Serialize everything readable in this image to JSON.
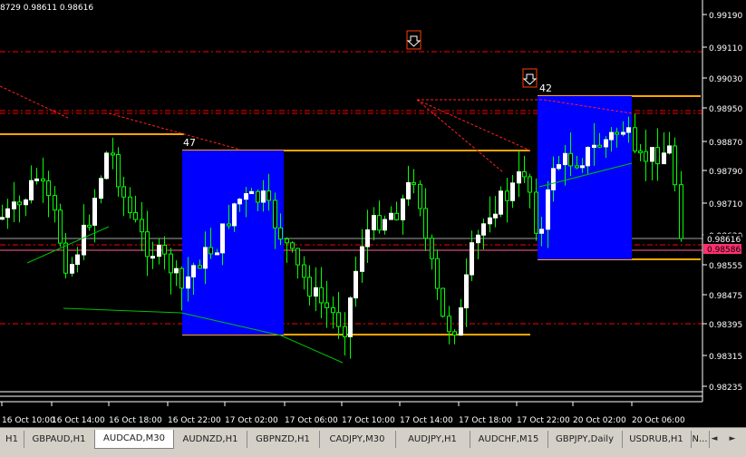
{
  "info_bar": {
    "text": "8729 0.98611 0.98616"
  },
  "price_axis": {
    "labels": [
      "0.99190",
      "0.99110",
      "0.99030",
      "0.98950",
      "0.98870",
      "0.98790",
      "0.98710",
      "0.98630",
      "0.98555",
      "0.98475",
      "0.98395",
      "0.98315",
      "0.98235"
    ],
    "current_bid": "0.98616",
    "current_ask": "0.98586"
  },
  "time_axis": {
    "labels": [
      "16 Oct 10:00",
      "16 Oct 14:00",
      "16 Oct 18:00",
      "16 Oct 22:00",
      "17 Oct 02:00",
      "17 Oct 06:00",
      "17 Oct 10:00",
      "17 Oct 14:00",
      "17 Oct 18:00",
      "17 Oct 22:00",
      "20 Oct 02:00",
      "20 Oct 06:00"
    ]
  },
  "zones": [
    {
      "label": "47"
    },
    {
      "label": "42"
    }
  ],
  "tabs": [
    "H1",
    "GBPAUD,H1",
    "AUDCAD,M30",
    "AUDNZD,H1",
    "GBPNZD,H1",
    "CADJPY,M30",
    "AUDJPY,H1",
    "AUDCHF,M15",
    "GBPJPY,Daily",
    "USDRUB,H1",
    "N..."
  ],
  "active_tab": 2,
  "nav": {
    "left": "◄",
    "right": "►"
  },
  "colors": {
    "background": "#000000",
    "axis": "#ffffff",
    "bull_candle": "#ffffff",
    "bear_candle": "#00ff00",
    "wick": "#00ff00",
    "zone": "#0000ff",
    "level": "#ffa500",
    "dash_level": "#ff0000",
    "ask_label": "#ff3070"
  }
}
